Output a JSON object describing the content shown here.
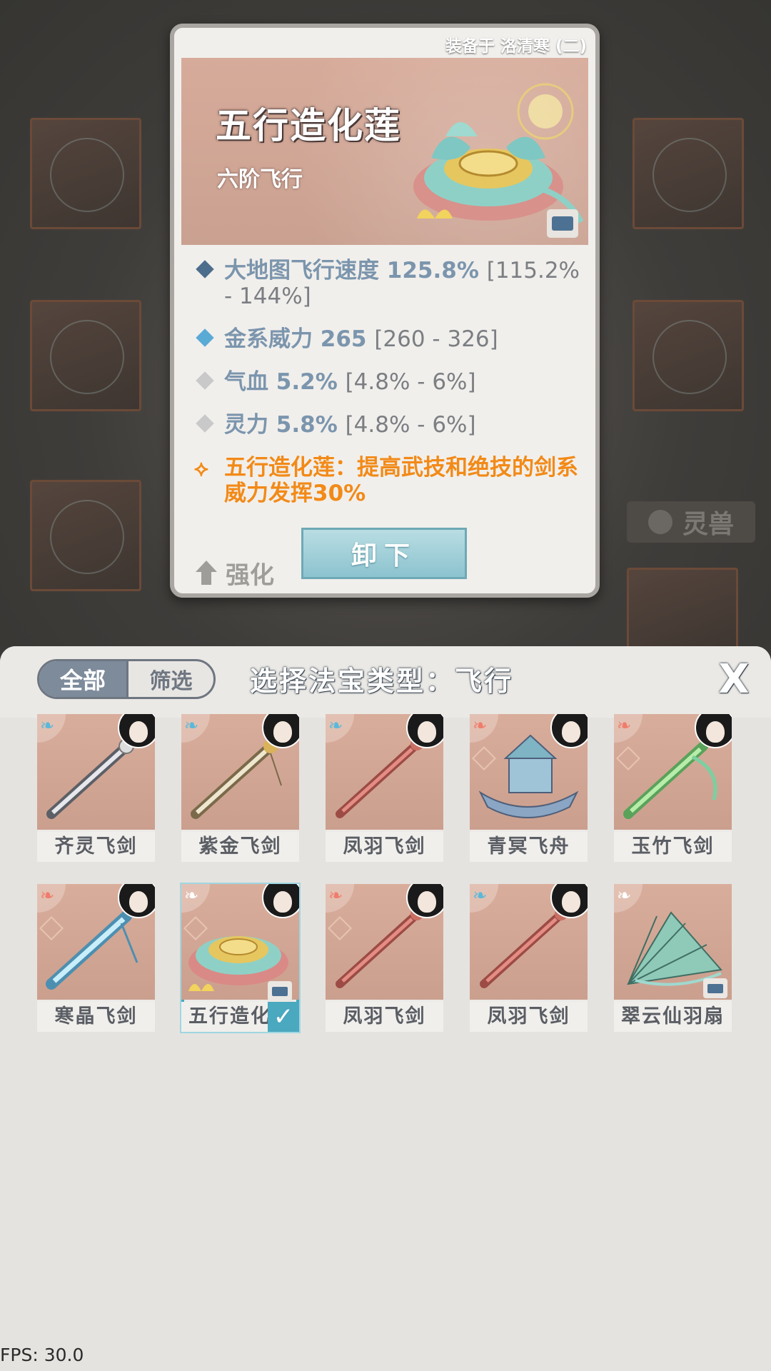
{
  "popup": {
    "equipped_text": "装备于 洛清寒 (二)",
    "item_name": "五行造化莲",
    "item_grade": "六阶飞行",
    "stats": [
      {
        "label": "大地图飞行速度",
        "value": "125.8%",
        "range": "[115.2% - 144%]",
        "color": "#4d6d8c"
      },
      {
        "label": "金系威力",
        "value": "265",
        "range": "[260 - 326]",
        "color": "#5aaad6"
      },
      {
        "label": "气血",
        "value": "5.2%",
        "range": "[4.8% - 6%]",
        "color": "#c9c9c9"
      },
      {
        "label": "灵力",
        "value": "5.8%",
        "range": "[4.8% - 6%]",
        "color": "#c9c9c9"
      }
    ],
    "special": "五行造化莲：提高武技和绝技的剑系威力发挥30%",
    "upgrade_label": "强化",
    "unequip_label": "卸下"
  },
  "background": {
    "tab_label": "灵兽"
  },
  "panel": {
    "tab_all": "全部",
    "tab_filter": "筛选",
    "title": "选择法宝类型：飞行",
    "close_label": "X"
  },
  "items": [
    {
      "name": "齐灵飞剑",
      "wing": "#5ab8d9",
      "element": false,
      "lock": false,
      "selected": false,
      "art": "sword-steel"
    },
    {
      "name": "紫金飞剑",
      "wing": "#5ab8d9",
      "element": false,
      "lock": false,
      "selected": false,
      "art": "sword-gold"
    },
    {
      "name": "凤羽飞剑",
      "wing": "#5ab8d9",
      "element": false,
      "lock": false,
      "selected": false,
      "art": "sword-red"
    },
    {
      "name": "青冥飞舟",
      "wing": "#f07c6c",
      "element": true,
      "lock": false,
      "selected": false,
      "art": "boat"
    },
    {
      "name": "玉竹飞剑",
      "wing": "#f07c6c",
      "element": true,
      "lock": false,
      "selected": false,
      "art": "sword-green"
    },
    {
      "name": "寒晶飞剑",
      "wing": "#f07c6c",
      "element": true,
      "lock": false,
      "selected": false,
      "art": "sword-ice"
    },
    {
      "name": "五行造化莲",
      "wing": "#ffffff",
      "element": true,
      "lock": true,
      "selected": true,
      "art": "lotus"
    },
    {
      "name": "凤羽飞剑",
      "wing": "#f07c6c",
      "element": true,
      "lock": false,
      "selected": false,
      "art": "sword-red"
    },
    {
      "name": "凤羽飞剑",
      "wing": "#5ab8d9",
      "element": false,
      "lock": false,
      "selected": false,
      "art": "sword-red"
    },
    {
      "name": "翠云仙羽扇",
      "wing": "#ffffff",
      "element": false,
      "lock": true,
      "selected": false,
      "art": "fan"
    }
  ],
  "fps": "FPS: 30.0"
}
